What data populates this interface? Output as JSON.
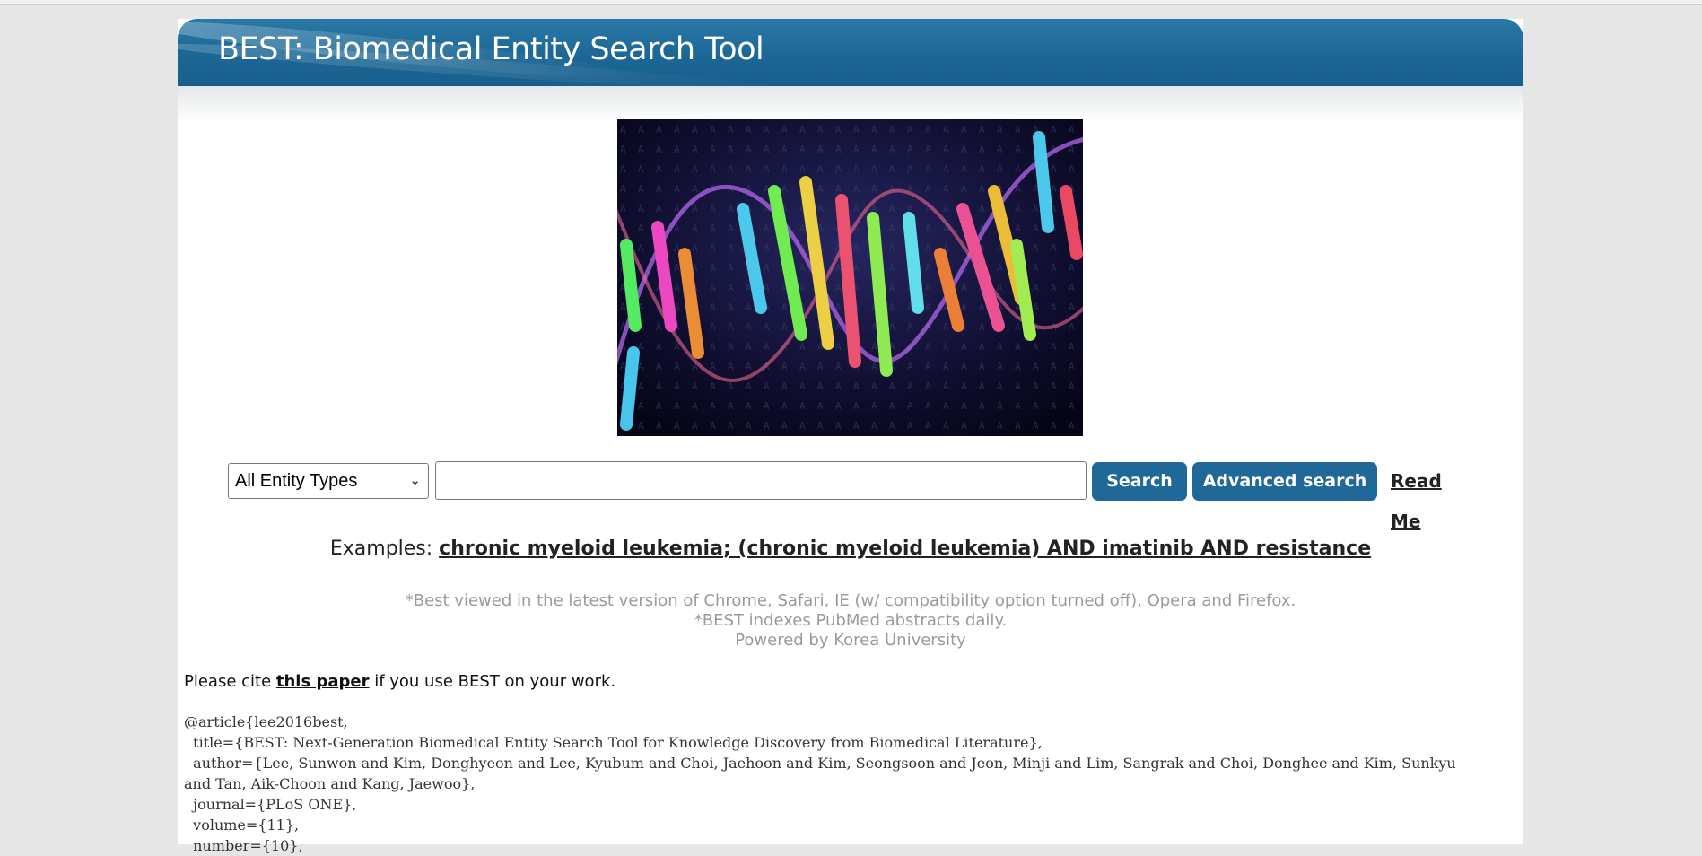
{
  "header": {
    "title": "BEST: Biomedical Entity Search Tool"
  },
  "hero": {
    "image_name": "dna-helix-image"
  },
  "search": {
    "entity_select_value": "All Entity Types",
    "input_value": "",
    "search_label": "Search",
    "advanced_label": "Advanced search",
    "readme_label": "Read Me"
  },
  "examples": {
    "prefix": "Examples: ",
    "example_1": "chronic myeloid leukemia",
    "separator": "; ",
    "example_2": "(chronic myeloid leukemia) AND imatinib AND resistance"
  },
  "notes": {
    "line1": "*Best viewed in the latest version of Chrome, Safari, IE (w/ compatibility option turned off), Opera and Firefox.",
    "line2": "*BEST indexes PubMed abstracts daily.",
    "line3": "Powered by Korea University"
  },
  "citation": {
    "prefix": "Please cite ",
    "link": "this paper",
    "suffix": " if you use BEST on your work."
  },
  "bibtex": {
    "l1": "@article{lee2016best,",
    "l2": "  title={BEST: Next-Generation Biomedical Entity Search Tool for Knowledge Discovery from Biomedical Literature},",
    "l3": "  author={Lee, Sunwon and Kim, Donghyeon and Lee, Kyubum and Choi, Jaehoon and Kim, Seongsoon and Jeon, Minji and Lim, Sangrak and Choi, Donghee and Kim, Sunkyu and Tan, Aik-Choon and Kang, Jaewoo},",
    "l4": "  journal={PLoS ONE},",
    "l5": "  volume={11},",
    "l6": "  number={10},"
  }
}
